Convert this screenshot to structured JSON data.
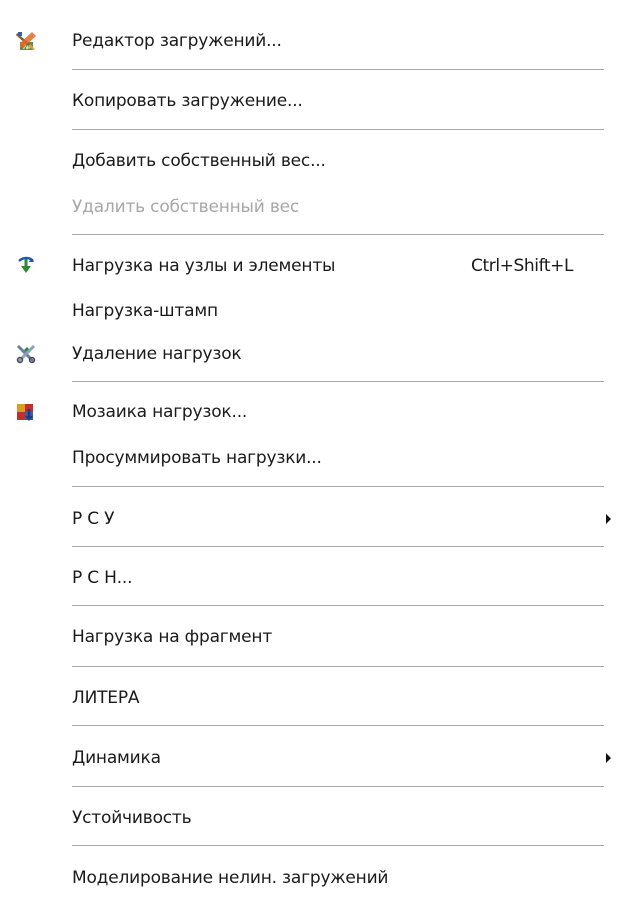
{
  "menu": {
    "items": [
      {
        "label": "Редактор загружений...",
        "icon": "load-editor-icon"
      },
      {
        "label": "Копировать загружение..."
      },
      {
        "label": "Добавить собственный вес..."
      },
      {
        "label": "Удалить собственный вес",
        "disabled": true
      },
      {
        "label": "Нагрузка на узлы и элементы",
        "shortcut": "Ctrl+Shift+L",
        "icon": "load-nodes-icon"
      },
      {
        "label": "Нагрузка-штамп"
      },
      {
        "label": "Удаление нагрузок",
        "icon": "delete-loads-icon"
      },
      {
        "label": "Мозаика нагрузок...",
        "icon": "mosaic-icon"
      },
      {
        "label": "Просуммировать нагрузки..."
      },
      {
        "label": "Р С У",
        "submenu": true
      },
      {
        "label": "Р С Н..."
      },
      {
        "label": "Нагрузка на фрагмент"
      },
      {
        "label": "ЛИТЕРА"
      },
      {
        "label": "Динамика",
        "submenu": true
      },
      {
        "label": "Устойчивость"
      },
      {
        "label": "Моделирование нелин. загружений"
      }
    ]
  },
  "colors": {
    "text": "#1a1a1a",
    "disabled_text": "#a7a7a7",
    "separator": "#a8a8a8",
    "background": "#ffffff"
  }
}
